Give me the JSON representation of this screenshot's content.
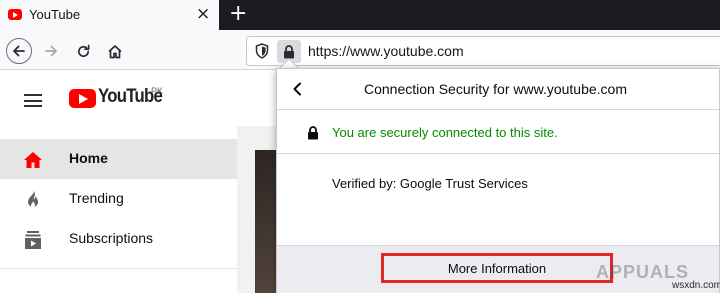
{
  "browser": {
    "tab_title": "YouTube",
    "tab_close": "×",
    "new_tab": "+",
    "url": "https://www.youtube.com"
  },
  "page": {
    "logo_word": "YouTube",
    "logo_country": "PK",
    "sidebar": [
      {
        "label": "Home",
        "icon": "home-icon",
        "active": true
      },
      {
        "label": "Trending",
        "icon": "flame-icon",
        "active": false
      },
      {
        "label": "Subscriptions",
        "icon": "subscriptions-icon",
        "active": false
      }
    ]
  },
  "popup": {
    "title": "Connection Security for www.youtube.com",
    "secure_text": "You are securely connected to this site.",
    "verified_text": "Verified by: Google Trust Services",
    "more_info_label": "More Information"
  },
  "watermark": {
    "brand": "APPUALS",
    "site": "wsxdn.com"
  },
  "colors": {
    "secure_green": "#058b00",
    "highlight_red": "#e02a2a",
    "youtube_red": "#ff0000",
    "tabstrip_dark": "#1c1b22"
  }
}
